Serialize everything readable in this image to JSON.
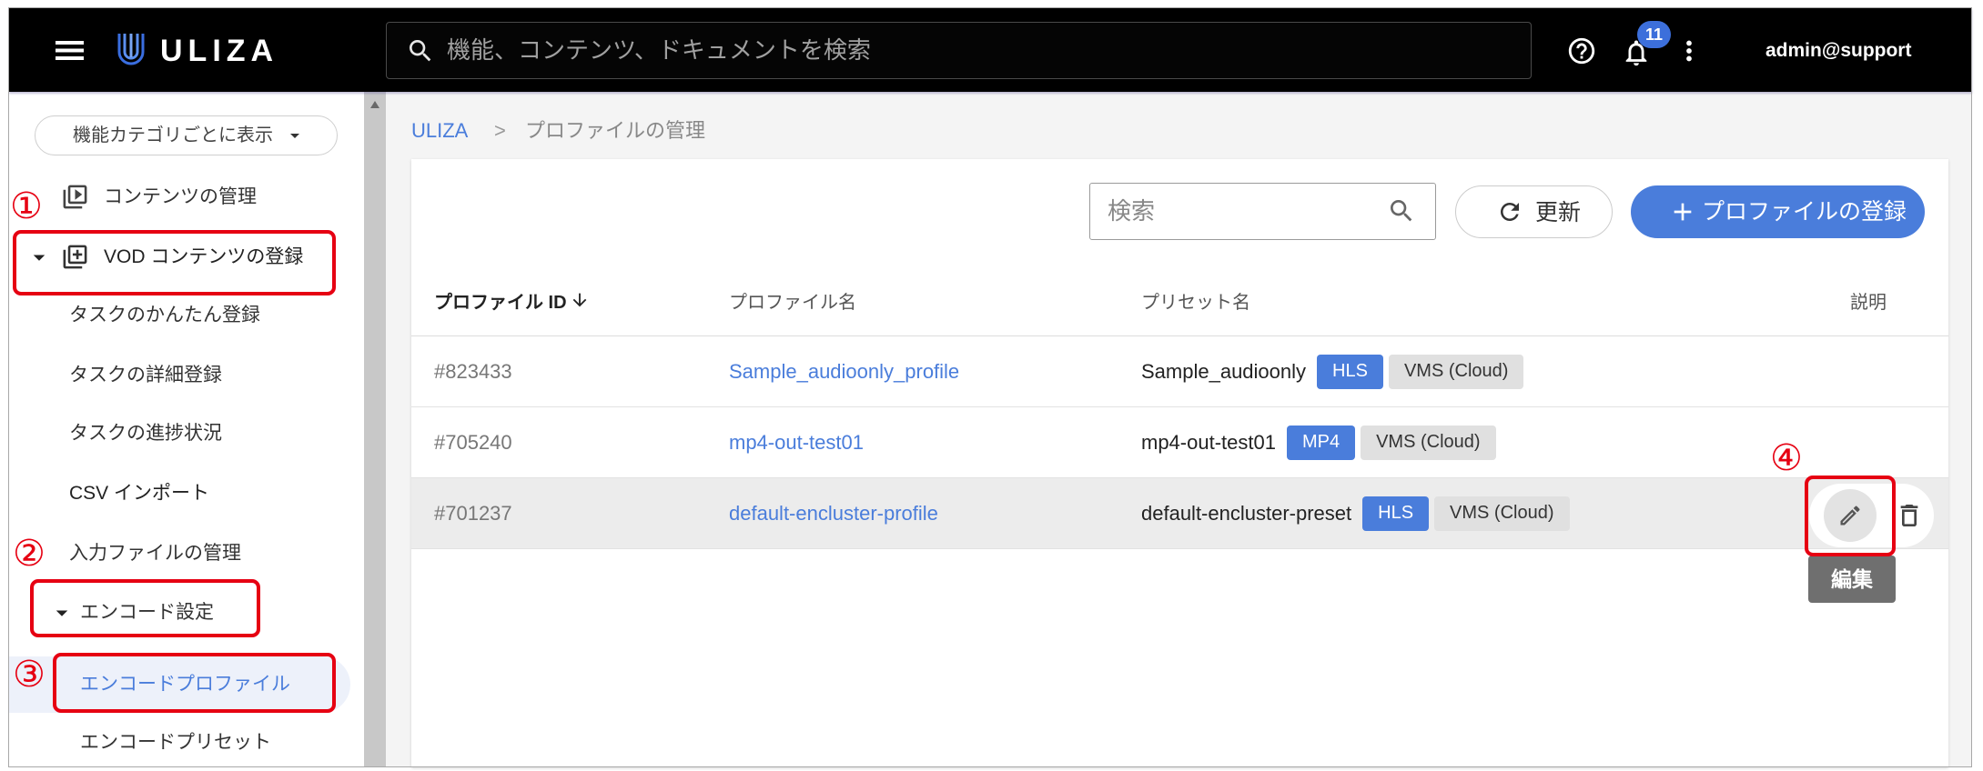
{
  "topbar": {
    "menu_icon": "hamburger-menu-icon",
    "logo_icon": "uliza-logo-icon",
    "logo_text": "ULIZA",
    "search_icon": "search-icon",
    "search_placeholder": "機能、コンテンツ、ドキュメントを検索",
    "help_icon": "help-icon",
    "notification_icon": "bell-icon",
    "notification_count": "11",
    "more_icon": "more-vert-icon",
    "user_name": "admin@support"
  },
  "sidebar": {
    "category_select": "機能カテゴリごとに表示",
    "items": [
      {
        "label": "コンテンツの管理",
        "icon": "video-library-icon"
      },
      {
        "label": "VOD コンテンツの登録",
        "icon": "library-add-icon",
        "expanded": true
      },
      {
        "label": "タスクのかんたん登録"
      },
      {
        "label": "タスクの詳細登録"
      },
      {
        "label": "タスクの進捗状況"
      },
      {
        "label": "CSV インポート"
      },
      {
        "label": "入力ファイルの管理"
      },
      {
        "label": "エンコード設定",
        "expanded": true
      },
      {
        "label": "エンコードプロファイル",
        "selected": true
      },
      {
        "label": "エンコードプリセット"
      }
    ]
  },
  "breadcrumb": {
    "root": "ULIZA",
    "separator": ">",
    "current": "プロファイルの管理"
  },
  "toolbar": {
    "search_placeholder": "検索",
    "refresh_icon": "refresh-icon",
    "refresh_label": "更新",
    "register_icon": "plus-icon",
    "register_label": "プロファイルの登録"
  },
  "table": {
    "headers": {
      "id": "プロファイル ID",
      "name": "プロファイル名",
      "preset": "プリセット名",
      "description": "説明"
    },
    "sort_icon": "arrow-downward-icon",
    "rows": [
      {
        "id": "#823433",
        "name": "Sample_audioonly_profile",
        "preset": "Sample_audioonly",
        "tags": [
          {
            "label": "HLS",
            "bg": "#4a7ddb",
            "fg": "#ffffff"
          },
          {
            "label": "VMS (Cloud)",
            "bg": "#e0e0e0",
            "fg": "#333333"
          }
        ]
      },
      {
        "id": "#705240",
        "name": "mp4-out-test01",
        "preset": "mp4-out-test01",
        "tags": [
          {
            "label": "MP4",
            "bg": "#4a7ddb",
            "fg": "#ffffff"
          },
          {
            "label": "VMS (Cloud)",
            "bg": "#e0e0e0",
            "fg": "#333333"
          }
        ]
      },
      {
        "id": "#701237",
        "name": "default-encluster-profile",
        "preset": "default-encluster-preset",
        "tags": [
          {
            "label": "HLS",
            "bg": "#4a7ddb",
            "fg": "#ffffff"
          },
          {
            "label": "VMS (Cloud)",
            "bg": "#e0e0e0",
            "fg": "#333333"
          }
        ]
      }
    ]
  },
  "row_actions": {
    "edit_icon": "edit-icon",
    "delete_icon": "delete-icon",
    "edit_tooltip": "編集"
  },
  "annotations": {
    "marker_1": "①",
    "marker_2": "②",
    "marker_3": "③",
    "marker_4": "④"
  },
  "colors": {
    "accent": "#4a7ddb",
    "topbar_bg": "#000000",
    "badge": "#3c6fdb",
    "selected_bg": "#edf1fa",
    "annotation_red": "#e60012"
  }
}
